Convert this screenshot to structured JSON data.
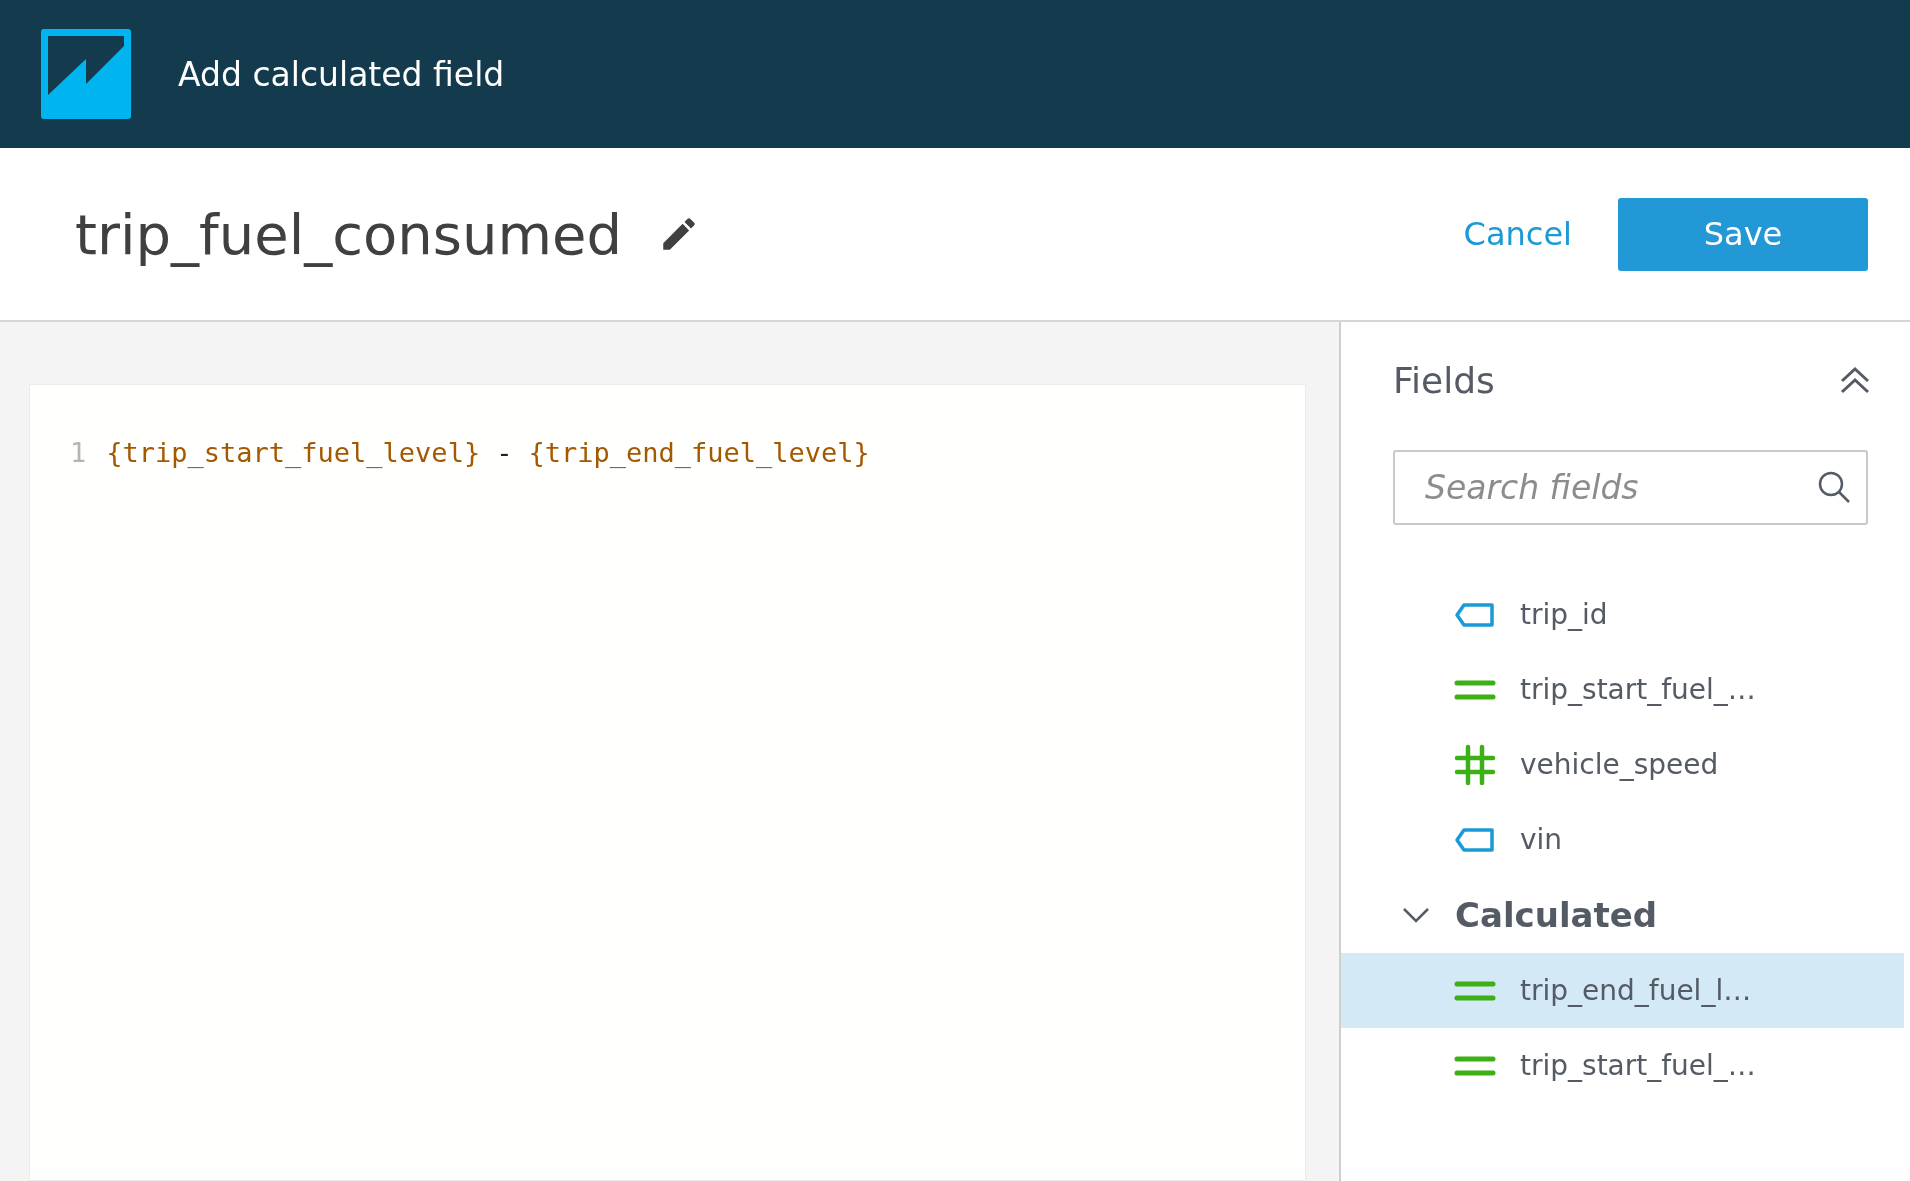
{
  "header": {
    "title": "Add calculated field"
  },
  "field_name": {
    "value": "trip_fuel_consumed"
  },
  "actions": {
    "cancel": "Cancel",
    "save": "Save"
  },
  "editor": {
    "lines": [
      {
        "number": "1",
        "tokens": [
          {
            "kind": "field",
            "text": "{trip_start_fuel_level}"
          },
          {
            "kind": "operator",
            "text": "-"
          },
          {
            "kind": "field",
            "text": "{trip_end_fuel_level}"
          }
        ]
      }
    ]
  },
  "fields_panel": {
    "title": "Fields",
    "search": {
      "placeholder": "Search fields"
    },
    "items": [
      {
        "kind": "text",
        "label": "trip_id",
        "selected": false
      },
      {
        "kind": "measure",
        "label": "trip_start_fuel_…",
        "selected": false
      },
      {
        "kind": "number",
        "label": "vehicle_speed",
        "selected": false
      },
      {
        "kind": "text",
        "label": "vin",
        "selected": false
      }
    ],
    "groups": [
      {
        "label": "Calculated",
        "expanded": true,
        "items": [
          {
            "kind": "measure",
            "label": "trip_end_fuel_l…",
            "selected": true
          },
          {
            "kind": "measure",
            "label": "trip_start_fuel_…",
            "selected": false
          }
        ]
      }
    ]
  }
}
